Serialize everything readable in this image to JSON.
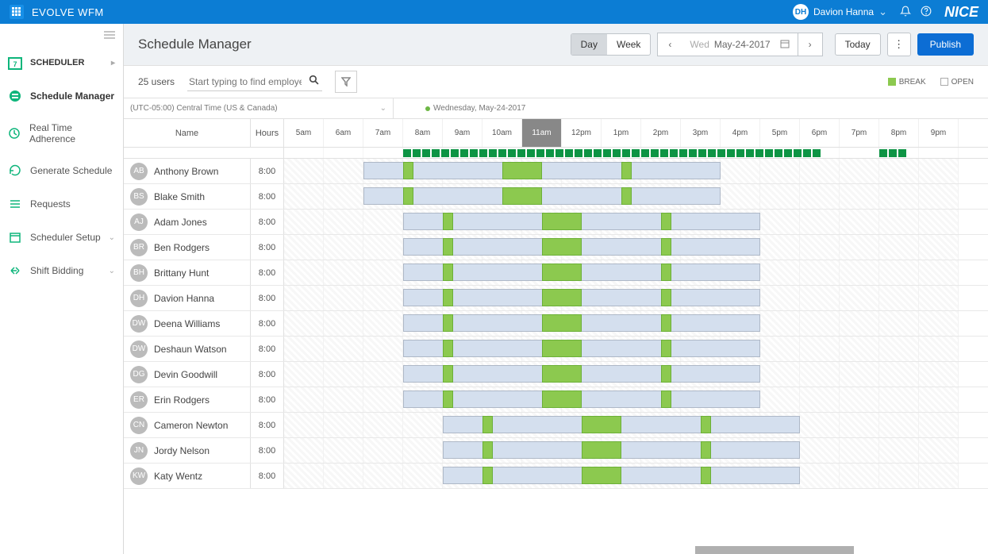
{
  "header": {
    "app_title": "EVOLVE WFM",
    "user_initials": "DH",
    "user_name": "Davion Hanna",
    "brand": "NICE"
  },
  "sidebar": {
    "section_label": "SCHEDULER",
    "items": [
      {
        "label": "Schedule Manager",
        "active": true
      },
      {
        "label": "Real Time Adherence"
      },
      {
        "label": "Generate Schedule"
      },
      {
        "label": "Requests"
      },
      {
        "label": "Scheduler Setup",
        "expandable": true
      },
      {
        "label": "Shift Bidding",
        "expandable": true
      }
    ]
  },
  "page": {
    "title": "Schedule Manager",
    "view_toggle": {
      "day": "Day",
      "week": "Week",
      "active": "day"
    },
    "date_weekday": "Wed",
    "date_value": "May-24-2017",
    "today_label": "Today",
    "publish_label": "Publish"
  },
  "filter": {
    "user_count": "25 users",
    "search_placeholder": "Start typing to find employee",
    "legend_break": "BREAK",
    "legend_open": "OPEN"
  },
  "grid": {
    "timezone": "(UTC-05:00) Central Time (US & Canada)",
    "day_label": "Wednesday, May-24-2017",
    "name_header": "Name",
    "hours_header": "Hours",
    "hours_start": 5,
    "hours_count": 17,
    "current_hour": 11,
    "coverage_slots_start": 3,
    "coverage_slots_end": 14,
    "extra_coverage_start": 15,
    "extra_coverage_count": 3
  },
  "employees": [
    {
      "initials": "AB",
      "name": "Anthony Brown",
      "hours": "8:00",
      "shift_start": 7,
      "shift_end": 16,
      "breaks": [
        8,
        10.5,
        13.5
      ],
      "lunch": 10.5
    },
    {
      "initials": "BS",
      "name": "Blake Smith",
      "hours": "8:00",
      "shift_start": 7,
      "shift_end": 16,
      "breaks": [
        8,
        10.5,
        13.5
      ],
      "lunch": 10.5
    },
    {
      "initials": "AJ",
      "name": "Adam Jones",
      "hours": "8:00",
      "shift_start": 8,
      "shift_end": 17,
      "breaks": [
        9,
        11.5,
        14.5
      ],
      "lunch": 11.5
    },
    {
      "initials": "BR",
      "name": "Ben Rodgers",
      "hours": "8:00",
      "shift_start": 8,
      "shift_end": 17,
      "breaks": [
        9,
        11.5,
        14.5
      ],
      "lunch": 11.5
    },
    {
      "initials": "BH",
      "name": "Brittany Hunt",
      "hours": "8:00",
      "shift_start": 8,
      "shift_end": 17,
      "breaks": [
        9,
        11.5,
        14.5
      ],
      "lunch": 11.5
    },
    {
      "initials": "DH",
      "name": "Davion Hanna",
      "hours": "8:00",
      "shift_start": 8,
      "shift_end": 17,
      "breaks": [
        9,
        11.5,
        14.5
      ],
      "lunch": 11.5
    },
    {
      "initials": "DW",
      "name": "Deena Williams",
      "hours": "8:00",
      "shift_start": 8,
      "shift_end": 17,
      "breaks": [
        9,
        11.5,
        14.5
      ],
      "lunch": 11.5
    },
    {
      "initials": "DW",
      "name": "Deshaun Watson",
      "hours": "8:00",
      "shift_start": 8,
      "shift_end": 17,
      "breaks": [
        9,
        11.5,
        14.5
      ],
      "lunch": 11.5
    },
    {
      "initials": "DG",
      "name": "Devin Goodwill",
      "hours": "8:00",
      "shift_start": 8,
      "shift_end": 17,
      "breaks": [
        9,
        11.5,
        14.5
      ],
      "lunch": 11.5
    },
    {
      "initials": "ER",
      "name": "Erin Rodgers",
      "hours": "8:00",
      "shift_start": 8,
      "shift_end": 17,
      "breaks": [
        9,
        11.5,
        14.5
      ],
      "lunch": 11.5
    },
    {
      "initials": "CN",
      "name": "Cameron Newton",
      "hours": "8:00",
      "shift_start": 9,
      "shift_end": 18,
      "breaks": [
        10,
        12.5,
        15.5
      ],
      "lunch": 12.5
    },
    {
      "initials": "JN",
      "name": "Jordy Nelson",
      "hours": "8:00",
      "shift_start": 9,
      "shift_end": 18,
      "breaks": [
        10,
        12.5,
        15.5
      ],
      "lunch": 12.5
    },
    {
      "initials": "KW",
      "name": "Katy Wentz",
      "hours": "8:00",
      "shift_start": 9,
      "shift_end": 18,
      "breaks": [
        10,
        12.5,
        15.5
      ],
      "lunch": 12.5
    }
  ]
}
